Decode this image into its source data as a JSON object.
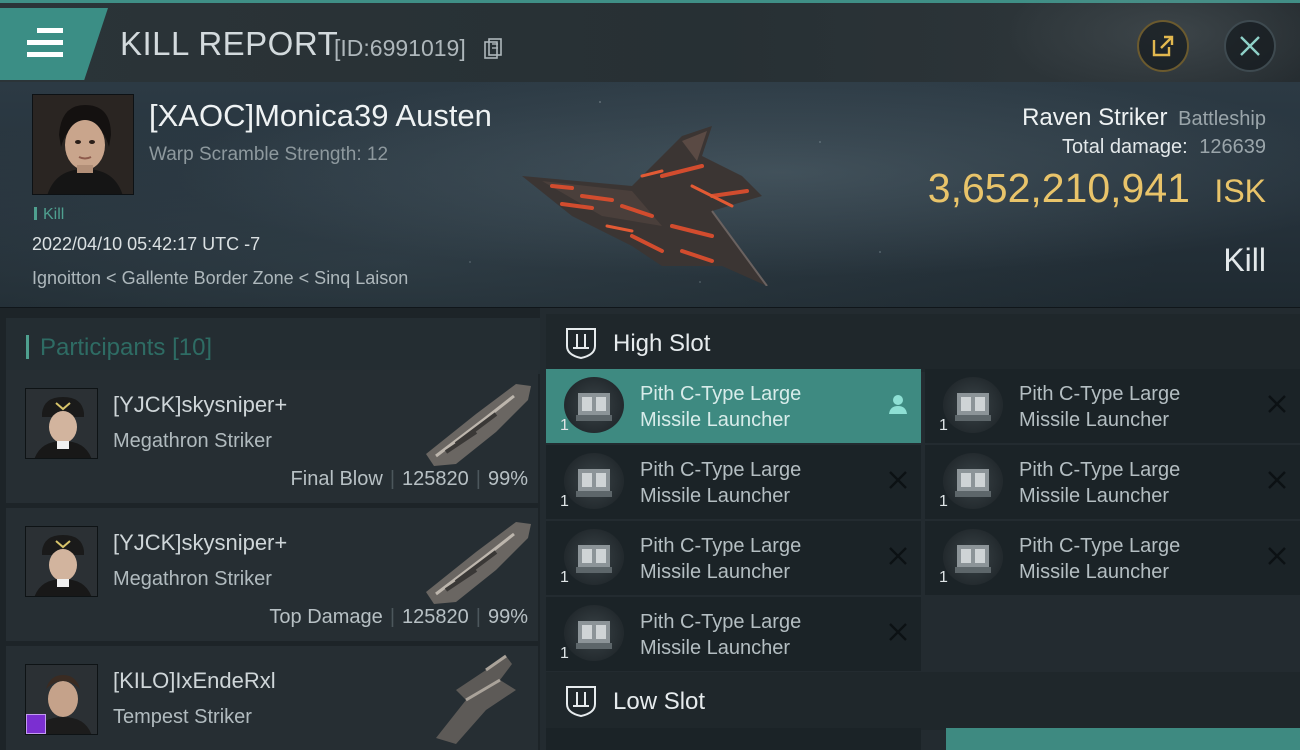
{
  "header": {
    "title": "KILL REPORT",
    "report_id": "[ID:6991019]",
    "icons": {
      "menu": "hamburger-icon",
      "copy": "copy-icon",
      "share": "external-share-icon",
      "close": "close-icon"
    },
    "accent_color": "#3b8e85"
  },
  "victim": {
    "name": "[XAOC]Monica39 Austen",
    "warp_scramble": "Warp Scramble Strength: 12",
    "tag": "Kill",
    "datetime": "2022/04/10 05:42:17 UTC -7",
    "location": "Ignoitton < Gallente Border Zone < Sinq Laison",
    "ship_name": "Raven Striker",
    "ship_class": "Battleship",
    "total_damage_label": "Total damage:",
    "total_damage": "126639",
    "isk_value": "3,652,210,941",
    "isk_unit": "ISK",
    "result": "Kill",
    "isk_color": "#e9c46a"
  },
  "participants": {
    "label": "Participants",
    "count": "[10]",
    "items": [
      {
        "name": "[YJCK]skysniper+",
        "ship": "Megathron Striker",
        "role": "Final Blow",
        "damage": "125820",
        "percent": "99%"
      },
      {
        "name": "[YJCK]skysniper+",
        "ship": "Megathron Striker",
        "role": "Top Damage",
        "damage": "125820",
        "percent": "99%"
      },
      {
        "name": "[KILO]IxEndeRxl",
        "ship": "Tempest Striker"
      }
    ]
  },
  "slots": {
    "high_slot_label": "High Slot",
    "low_slot_label": "Low Slot",
    "high_modules": [
      {
        "line1": "Pith C-Type Large",
        "line2": "Missile Launcher",
        "qty": "1",
        "status": "pilot-icon"
      },
      {
        "line1": "Pith C-Type Large",
        "line2": "Missile Launcher",
        "qty": "1",
        "status": "destroyed-x-icon"
      },
      {
        "line1": "Pith C-Type Large",
        "line2": "Missile Launcher",
        "qty": "1",
        "status": "destroyed-x-icon"
      },
      {
        "line1": "Pith C-Type Large",
        "line2": "Missile Launcher",
        "qty": "1",
        "status": "destroyed-x-icon"
      },
      {
        "line1": "Pith C-Type Large",
        "line2": "Missile Launcher",
        "qty": "1",
        "status": "destroyed-x-icon"
      },
      {
        "line1": "Pith C-Type Large",
        "line2": "Missile Launcher",
        "qty": "1",
        "status": "destroyed-x-icon"
      },
      {
        "line1": "Pith C-Type Large",
        "line2": "Missile Launcher",
        "qty": "1",
        "status": "destroyed-x-icon"
      }
    ]
  }
}
